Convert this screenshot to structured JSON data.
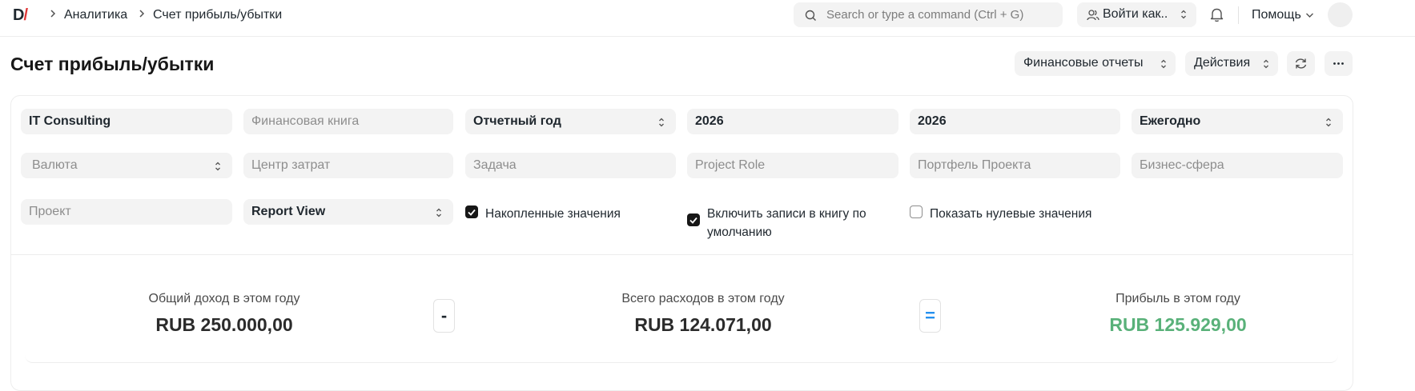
{
  "navbar": {
    "logo_main": "D",
    "logo_slash": "/",
    "breadcrumbs": [
      "Аналитика",
      "Счет прибыль/убытки"
    ],
    "search_placeholder": "Search or type a command (Ctrl + G)",
    "login_as_label": "Войти как..",
    "help_label": "Помощь"
  },
  "page": {
    "title": "Счет прибыль/убытки",
    "actions": {
      "financial_reports_label": "Финансовые отчеты",
      "actions_label": "Действия"
    }
  },
  "filters": {
    "company": "IT Consulting",
    "finance_book_placeholder": "Финансовая книга",
    "period_type": "Отчетный год",
    "from_year": "2026",
    "to_year": "2026",
    "periodicity": "Ежегодно",
    "currency_placeholder": "Валюта",
    "cost_center_placeholder": "Центр затрат",
    "task_placeholder": "Задача",
    "project_role_placeholder": "Project Role",
    "project_portfolio_placeholder": "Портфель Проекта",
    "business_area_placeholder": "Бизнес-сфера",
    "project_placeholder": "Проект",
    "report_view": "Report View",
    "accumulated_values_label": "Накопленные значения",
    "accumulated_values_checked": true,
    "include_default_book_label": "Включить записи в книгу по умолчанию",
    "include_default_book_checked": true,
    "show_zero_values_label": "Показать нулевые значения",
    "show_zero_values_checked": false
  },
  "summary": {
    "income_caption": "Общий доход в этом году",
    "income_value": "RUB 250.000,00",
    "minus_symbol": "-",
    "expense_caption": "Всего расходов в этом году",
    "expense_value": "RUB 124.071,00",
    "equals_symbol": "=",
    "profit_caption": "Прибыль в этом году",
    "profit_value": "RUB 125.929,00",
    "profit_color": "#59b179"
  }
}
